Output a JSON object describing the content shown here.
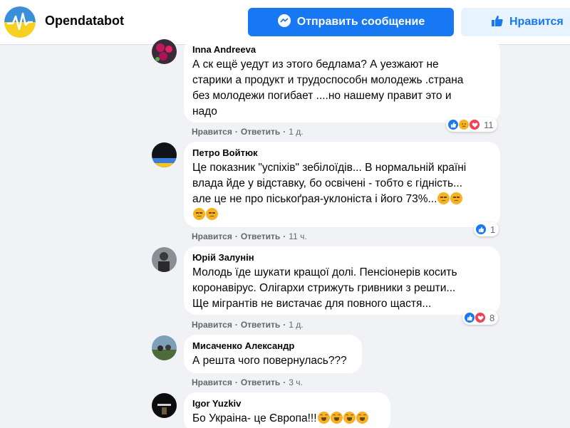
{
  "header": {
    "page_name": "Opendatabot",
    "message_button": "Отправить сообщение",
    "like_button": "Нравится"
  },
  "actions_labels": {
    "like": "Нравится",
    "reply": "Ответить",
    "sep": "·"
  },
  "comments": [
    {
      "author": "Inna Andreeva",
      "text": "А ск ещё уедут из этого бедлама? А уезжают не\nстарики а продукт и трудоспособн молодежь .страна\nбез молодежи погибает ....но нашему правит это и\nнадо",
      "time": "1 д.",
      "reactions": [
        "like",
        "sad",
        "love"
      ],
      "reaction_count": "11"
    },
    {
      "author": "Петро Войтюк",
      "text": "Це показник \"успіхів\" зебілоїдів... В нормальній країні\nвлада йде у відставку, бо освічені - тобто є гідність...\nале це не про піськоґрая-уклоніста і його 73%...",
      "time": "11 ч.",
      "reactions": [
        "like"
      ],
      "reaction_count": "1"
    },
    {
      "author": "Юрій Залунін",
      "text": "Молодь їде шукати кращої долі. Пенсіонерів косить\nкоронавірус. Олігархи стрижуть гривники з решти...\nЩе мігрантів не вистачає для повного щастя...",
      "time": "1 д.",
      "reactions": [
        "like",
        "love"
      ],
      "reaction_count": "8"
    },
    {
      "author": "Мисаченко Александр",
      "text": "А решта чого повернулась???",
      "time": "3 ч.",
      "reactions": [],
      "reaction_count": ""
    },
    {
      "author": "Igor Yuzkiv",
      "text": "Бо Украіна- це Європа!!!",
      "time": "",
      "reactions": [],
      "reaction_count": ""
    }
  ]
}
